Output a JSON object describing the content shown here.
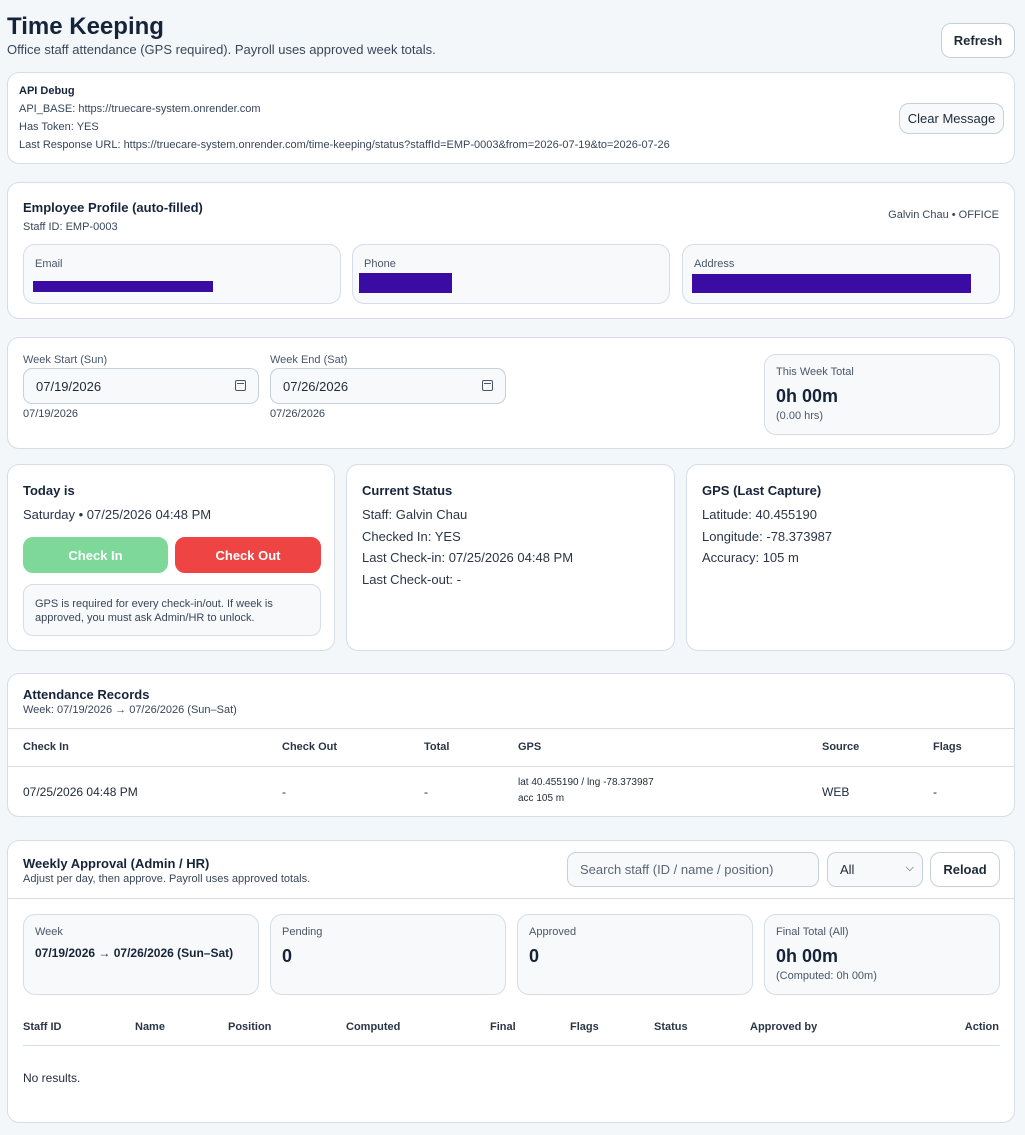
{
  "header": {
    "title": "Time Keeping",
    "subtitle": "Office staff attendance (GPS required). Payroll uses approved week totals.",
    "refresh_label": "Refresh"
  },
  "debug": {
    "title": "API Debug",
    "api_base_label": "API_BASE:",
    "api_base": "https://truecare-system.onrender.com",
    "token_label": "Has Token:",
    "token": "YES",
    "url_label": "Last Response URL:",
    "url": "https://truecare-system.onrender.com/time-keeping/status?staffId=EMP-0003&from=2026-07-19&to=2026-07-26",
    "clear_label": "Clear Message"
  },
  "profile": {
    "title": "Employee Profile (auto-filled)",
    "staff_id": "Staff ID: EMP-0003",
    "name_role": "Galvin Chau • OFFICE",
    "email_label": "Email",
    "phone_label": "Phone",
    "address_label": "Address"
  },
  "week": {
    "start_label": "Week Start (Sun)",
    "start_value": "07/19/2026",
    "start_hint": "07/19/2026",
    "end_label": "Week End (Sat)",
    "end_value": "07/26/2026",
    "end_hint": "07/26/2026",
    "total_label": "This Week Total",
    "total_value": "0h 00m",
    "total_hrs": "(0.00 hrs)"
  },
  "today": {
    "title": "Today is",
    "date": "Saturday • 07/25/2026 04:48 PM",
    "check_in": "Check In",
    "check_out": "Check Out",
    "note": "GPS is required for every check-in/out. If week is approved, you must ask Admin/HR to unlock."
  },
  "status": {
    "title": "Current Status",
    "staff_label": "Staff:",
    "staff": "Galvin Chau",
    "checked_label": "Checked In:",
    "checked": "YES",
    "last_in_label": "Last Check-in:",
    "last_in": "07/25/2026 04:48 PM",
    "last_out_label": "Last Check-out:",
    "last_out": "-"
  },
  "gps": {
    "title": "GPS (Last Capture)",
    "lat_label": "Latitude:",
    "lat": "40.455190",
    "lng_label": "Longitude:",
    "lng": "-78.373987",
    "acc_label": "Accuracy:",
    "acc": "105 m"
  },
  "records": {
    "title": "Attendance Records",
    "subtitle": "Week: 07/19/2026 → 07/26/2026 (Sun–Sat)",
    "columns": [
      "Check In",
      "Check Out",
      "Total",
      "GPS",
      "Source",
      "Flags"
    ],
    "rows": [
      {
        "check_in": "07/25/2026 04:48 PM",
        "check_out": "-",
        "total": "-",
        "gps_line1": "lat 40.455190 / lng -78.373987",
        "gps_line2": "acc 105 m",
        "source": "WEB",
        "flags": "-"
      }
    ]
  },
  "approval": {
    "title": "Weekly Approval (Admin / HR)",
    "subtitle": "Adjust per day, then approve. Payroll uses approved totals.",
    "search_placeholder": "Search staff (ID / name / position)",
    "filter_value": "All",
    "reload_label": "Reload",
    "week_label": "Week",
    "week_value": "07/19/2026 → 07/26/2026 (Sun–Sat)",
    "pending_label": "Pending",
    "pending_value": "0",
    "approved_label": "Approved",
    "approved_value": "0",
    "final_label": "Final Total (All)",
    "final_value": "0h 00m",
    "final_computed": "(Computed: 0h 00m)",
    "columns": [
      "Staff ID",
      "Name",
      "Position",
      "Computed",
      "Final",
      "Flags",
      "Status",
      "Approved by",
      "Action"
    ],
    "empty": "No results."
  },
  "colors": {
    "check_in": "#7dd89a",
    "check_out": "#ef4444",
    "redaction": "#3a0ca3"
  }
}
